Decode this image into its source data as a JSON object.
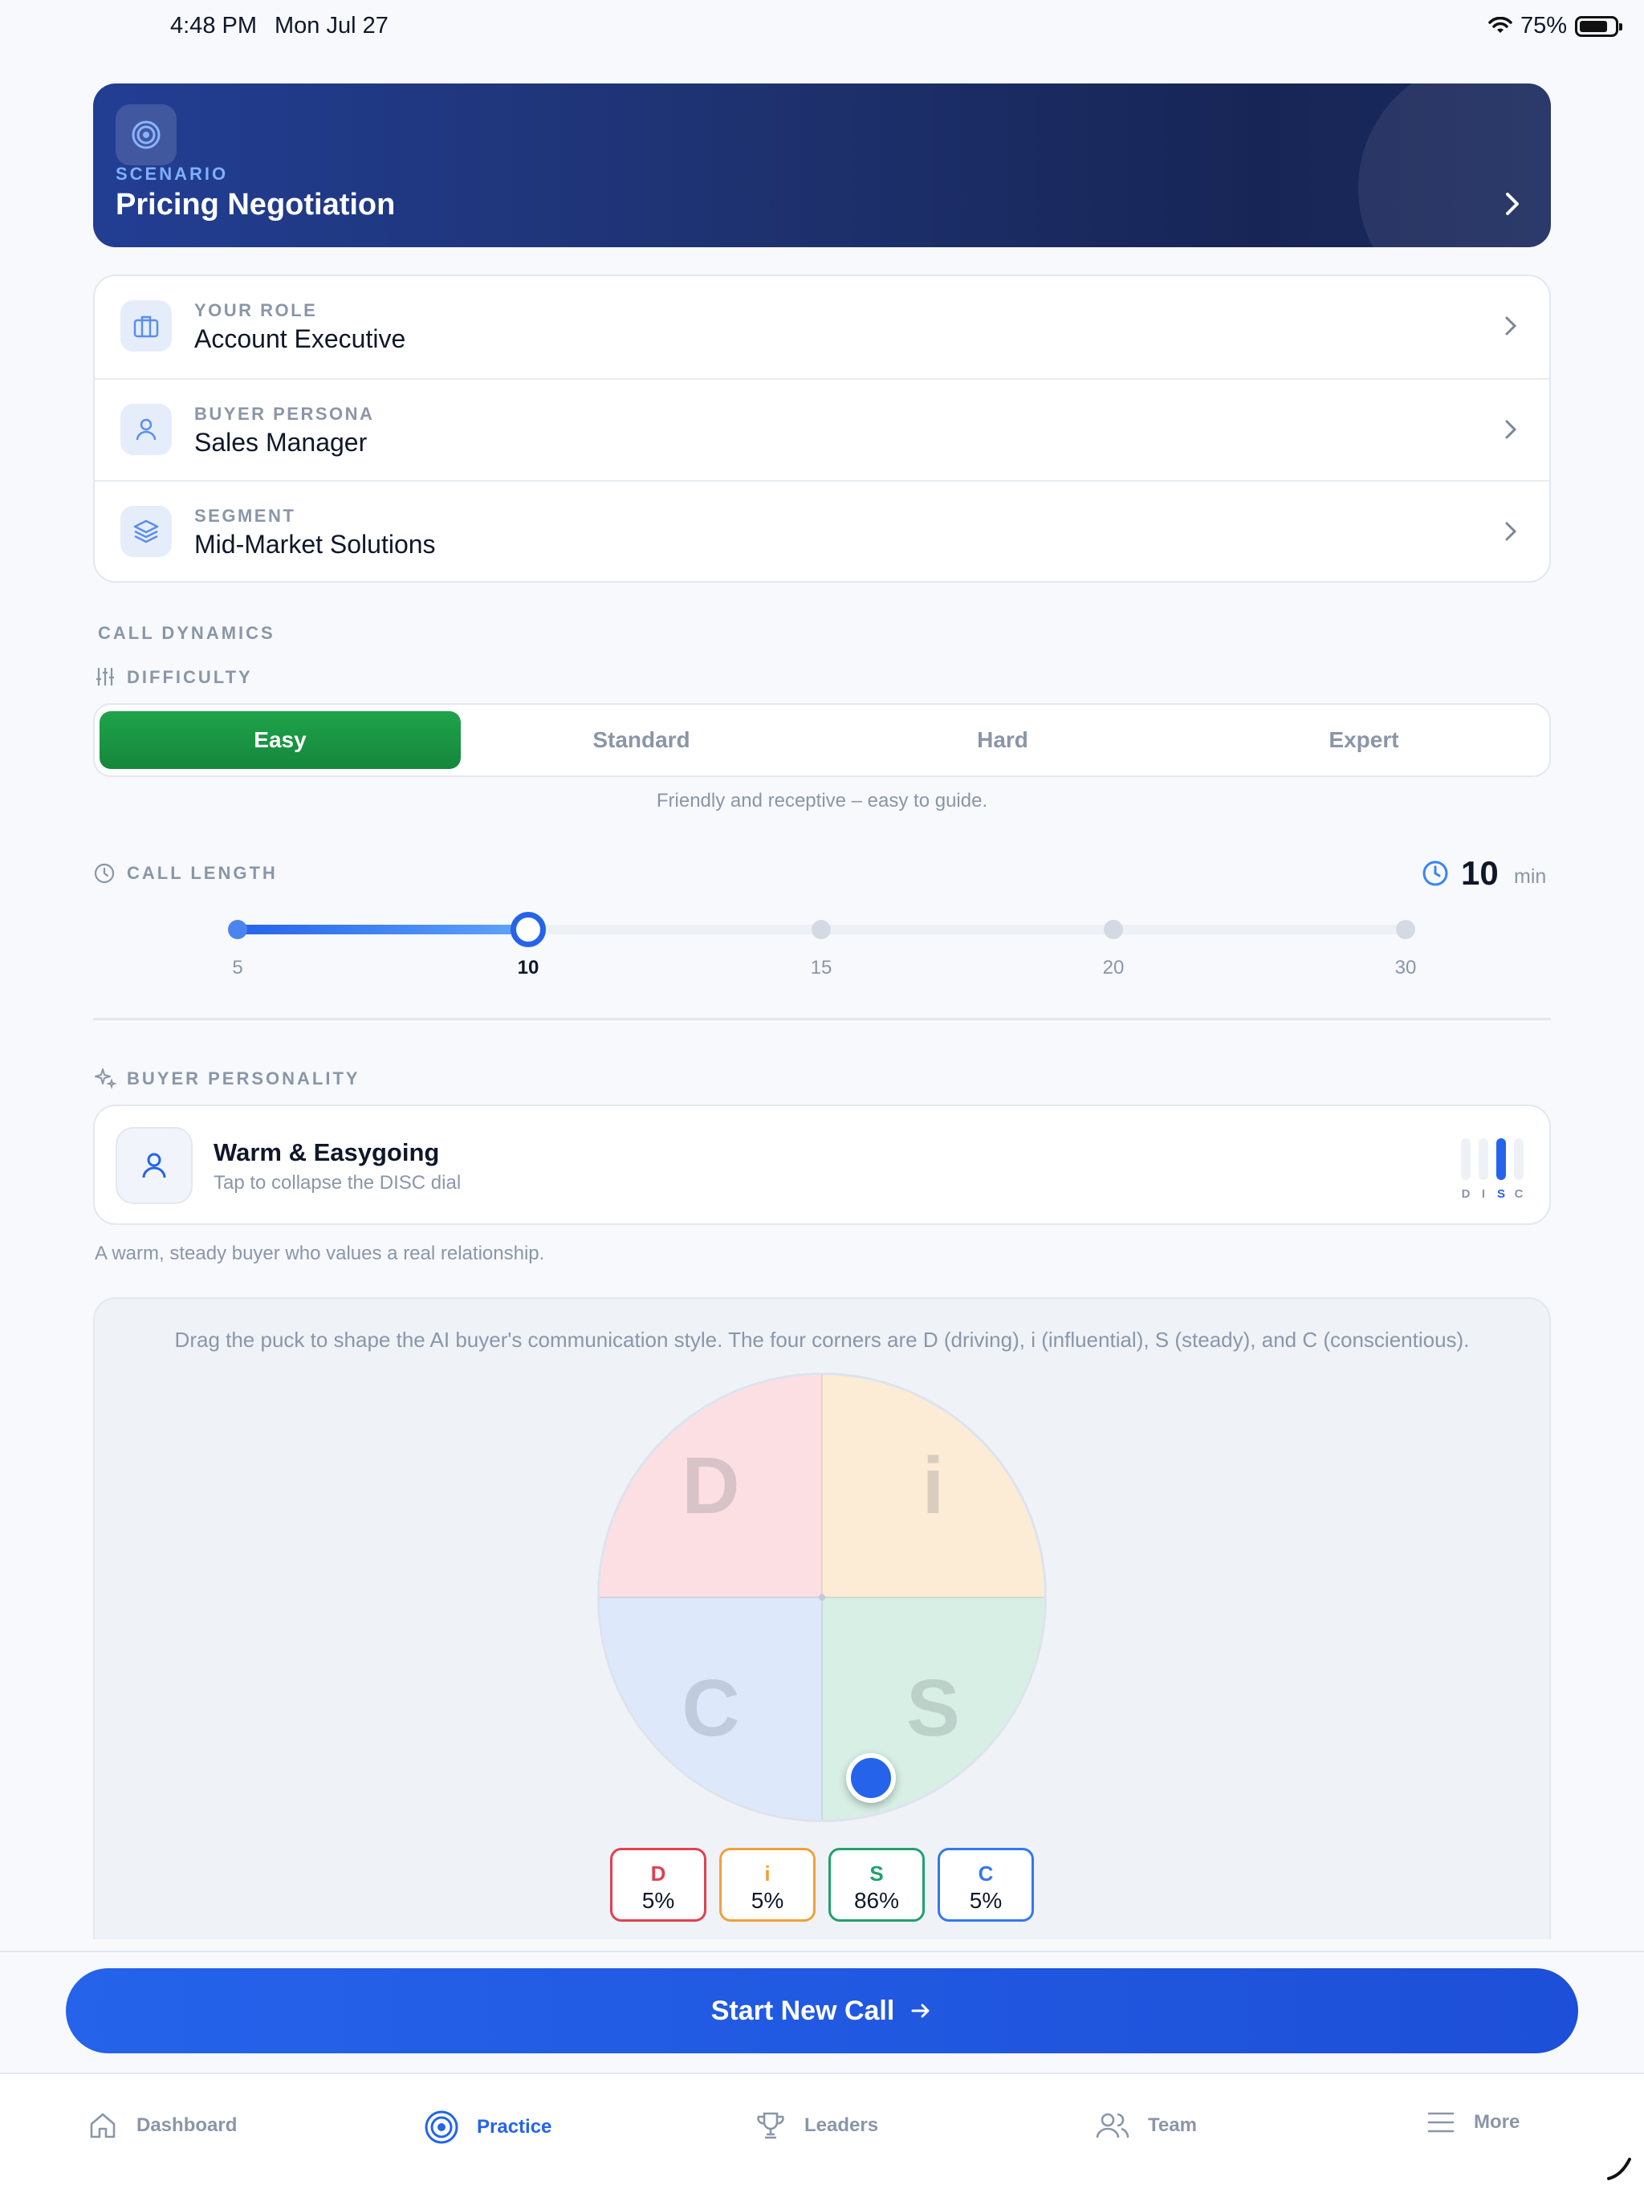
{
  "status_bar": {
    "time": "4:48 PM",
    "date": "Mon Jul 27",
    "battery": "75%"
  },
  "scenario": {
    "kicker": "SCENARIO",
    "title": "Pricing Negotiation"
  },
  "settings": [
    {
      "key": "YOUR ROLE",
      "value": "Account Executive",
      "icon": "briefcase-icon"
    },
    {
      "key": "BUYER PERSONA",
      "value": "Sales Manager",
      "icon": "person-icon"
    },
    {
      "key": "SEGMENT",
      "value": "Mid-Market Solutions",
      "icon": "layers-icon"
    }
  ],
  "call_dynamics": {
    "section_label": "CALL DYNAMICS",
    "difficulty_label": "DIFFICULTY",
    "difficulty_options": [
      "Easy",
      "Standard",
      "Hard",
      "Expert"
    ],
    "difficulty_selected": "Easy",
    "difficulty_hint": "Friendly and receptive – easy to guide."
  },
  "call_length": {
    "label": "CALL LENGTH",
    "value": "10",
    "unit": "min",
    "ticks": [
      "5",
      "10",
      "15",
      "20",
      "30"
    ],
    "selected": "10"
  },
  "personality": {
    "label": "BUYER PERSONALITY",
    "title": "Warm & Easygoing",
    "subtitle": "Tap to collapse the DISC dial",
    "description": "A warm, steady buyer who values a real relationship.",
    "mini_bar_letters": [
      "D",
      "I",
      "S",
      "C"
    ],
    "mini_bar_active": "S"
  },
  "disc_panel": {
    "instructions": "Drag the puck to shape the AI buyer's communication style. The four corners are D (driving), i (influential), S (steady), and C (conscientious).",
    "quadrants": {
      "d": "D",
      "i": "i",
      "c": "C",
      "s": "S"
    },
    "chips": [
      {
        "letter": "D",
        "value": "5%",
        "color": "#e0414f"
      },
      {
        "letter": "i",
        "value": "5%",
        "color": "#f0a13a"
      },
      {
        "letter": "S",
        "value": "86%",
        "color": "#21a06b"
      },
      {
        "letter": "C",
        "value": "5%",
        "color": "#3478f0"
      }
    ]
  },
  "cta": {
    "label": "Start New Call"
  },
  "tabs": [
    {
      "label": "Dashboard",
      "icon": "home-icon"
    },
    {
      "label": "Practice",
      "icon": "target-icon",
      "active": true
    },
    {
      "label": "Leaders",
      "icon": "trophy-icon"
    },
    {
      "label": "Team",
      "icon": "users-icon"
    },
    {
      "label": "More",
      "icon": "menu-icon"
    }
  ],
  "colors": {
    "accent": "#2563eb",
    "success": "#1fa34a",
    "hero_bg": "#1e3270"
  }
}
